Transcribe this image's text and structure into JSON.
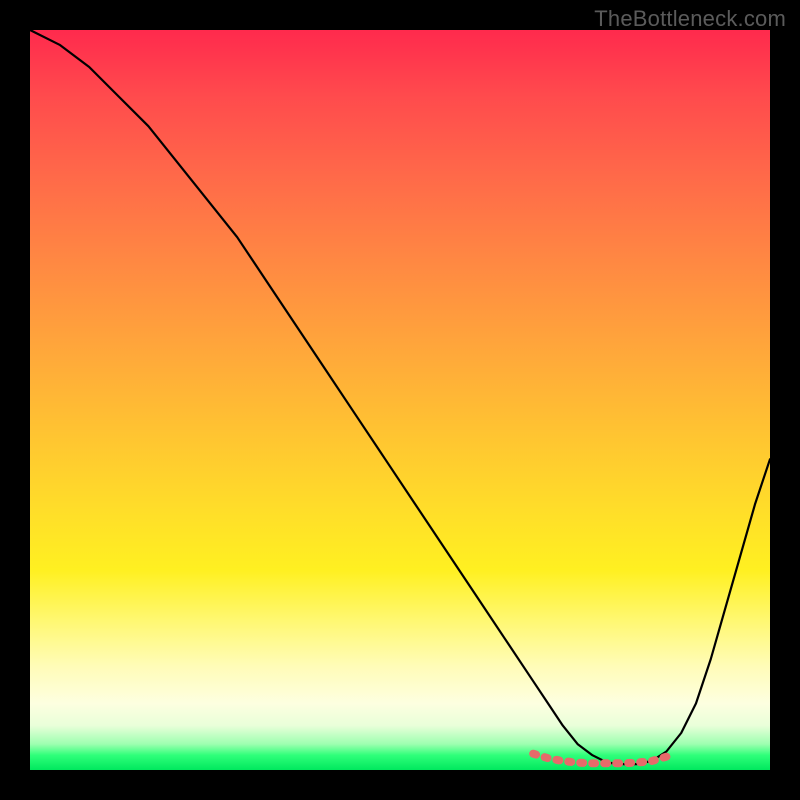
{
  "watermark": "TheBottleneck.com",
  "chart_data": {
    "type": "line",
    "title": "",
    "xlabel": "",
    "ylabel": "",
    "xlim": [
      0,
      100
    ],
    "ylim": [
      0,
      100
    ],
    "series": [
      {
        "name": "bottleneck-curve",
        "x": [
          0,
          4,
          8,
          12,
          16,
          20,
          24,
          28,
          32,
          36,
          40,
          44,
          48,
          52,
          56,
          60,
          64,
          68,
          70,
          72,
          74,
          76,
          78,
          80,
          82,
          84,
          86,
          88,
          90,
          92,
          94,
          96,
          98,
          100
        ],
        "values": [
          100,
          98,
          95,
          91,
          87,
          82,
          77,
          72,
          66,
          60,
          54,
          48,
          42,
          36,
          30,
          24,
          18,
          12,
          9,
          6,
          3.5,
          2,
          1,
          0.8,
          0.8,
          1.2,
          2.5,
          5,
          9,
          15,
          22,
          29,
          36,
          42
        ]
      },
      {
        "name": "optimal-marker",
        "x": [
          68,
          70,
          72,
          74,
          76,
          78,
          80,
          82,
          84,
          86
        ],
        "values": [
          2.2,
          1.6,
          1.2,
          1.0,
          0.9,
          0.9,
          0.9,
          1.0,
          1.2,
          1.8
        ]
      }
    ],
    "annotations": []
  },
  "colors": {
    "curve": "#000000",
    "marker": "#e66a6a",
    "background_top": "#ff2a4d",
    "background_bottom": "#00e85e",
    "frame": "#000000"
  }
}
